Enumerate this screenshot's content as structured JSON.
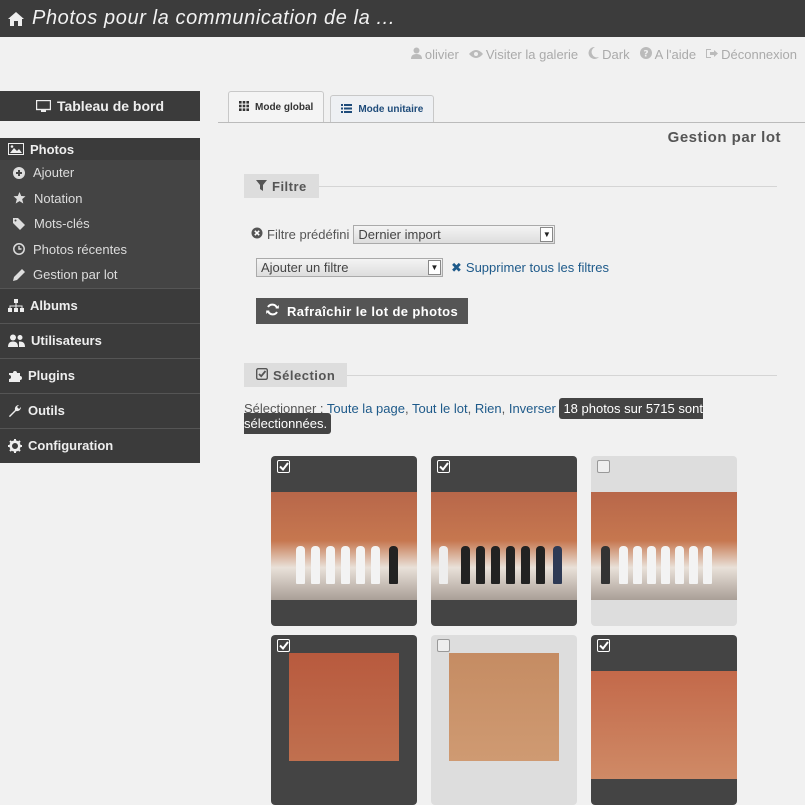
{
  "header": {
    "title": "Photos pour la communication de la ..."
  },
  "userbar": [
    {
      "icon": "user-icon",
      "label": "olivier"
    },
    {
      "icon": "eye-icon",
      "label": "Visiter la galerie"
    },
    {
      "icon": "moon-icon",
      "label": "Dark"
    },
    {
      "icon": "question-icon",
      "label": "A l'aide"
    },
    {
      "icon": "signout-icon",
      "label": "Déconnexion"
    }
  ],
  "sidebar": {
    "dashboard": "Tableau de bord",
    "photos": {
      "label": "Photos",
      "items": [
        {
          "icon": "plus-circle-icon",
          "label": "Ajouter"
        },
        {
          "icon": "star-icon",
          "label": "Notation"
        },
        {
          "icon": "tags-icon",
          "label": "Mots-clés"
        },
        {
          "icon": "clock-icon",
          "label": "Photos récentes"
        },
        {
          "icon": "pencil-icon",
          "label": "Gestion par lot"
        }
      ]
    },
    "menus": [
      {
        "icon": "sitemap-icon",
        "label": "Albums"
      },
      {
        "icon": "users-icon",
        "label": "Utilisateurs"
      },
      {
        "icon": "puzzle-icon",
        "label": "Plugins"
      },
      {
        "icon": "wrench-icon",
        "label": "Outils"
      },
      {
        "icon": "cog-icon",
        "label": "Configuration"
      }
    ]
  },
  "tabs": [
    {
      "label": "Mode global",
      "active": true
    },
    {
      "label": "Mode unitaire",
      "active": false
    }
  ],
  "page": {
    "heading": "Gestion par lot"
  },
  "filter": {
    "legend": "Filtre",
    "predefined_label": "Filtre prédéfini",
    "predefined_value": "Dernier import",
    "add_filter_value": "Ajouter un filtre",
    "remove_all_label": "Supprimer tous les filtres",
    "refresh_button": "Rafraîchir le lot de photos"
  },
  "selection": {
    "legend": "Sélection",
    "prompt": "Sélectionner :",
    "links": [
      "Toute la page",
      "Tout le lot",
      "Rien",
      "Inverser"
    ],
    "count_text": "18 photos sur 5715 sont sélectionnées."
  },
  "thumbnails": [
    {
      "selected": true
    },
    {
      "selected": true
    },
    {
      "selected": false
    },
    {
      "selected": true
    },
    {
      "selected": false
    },
    {
      "selected": true
    }
  ]
}
